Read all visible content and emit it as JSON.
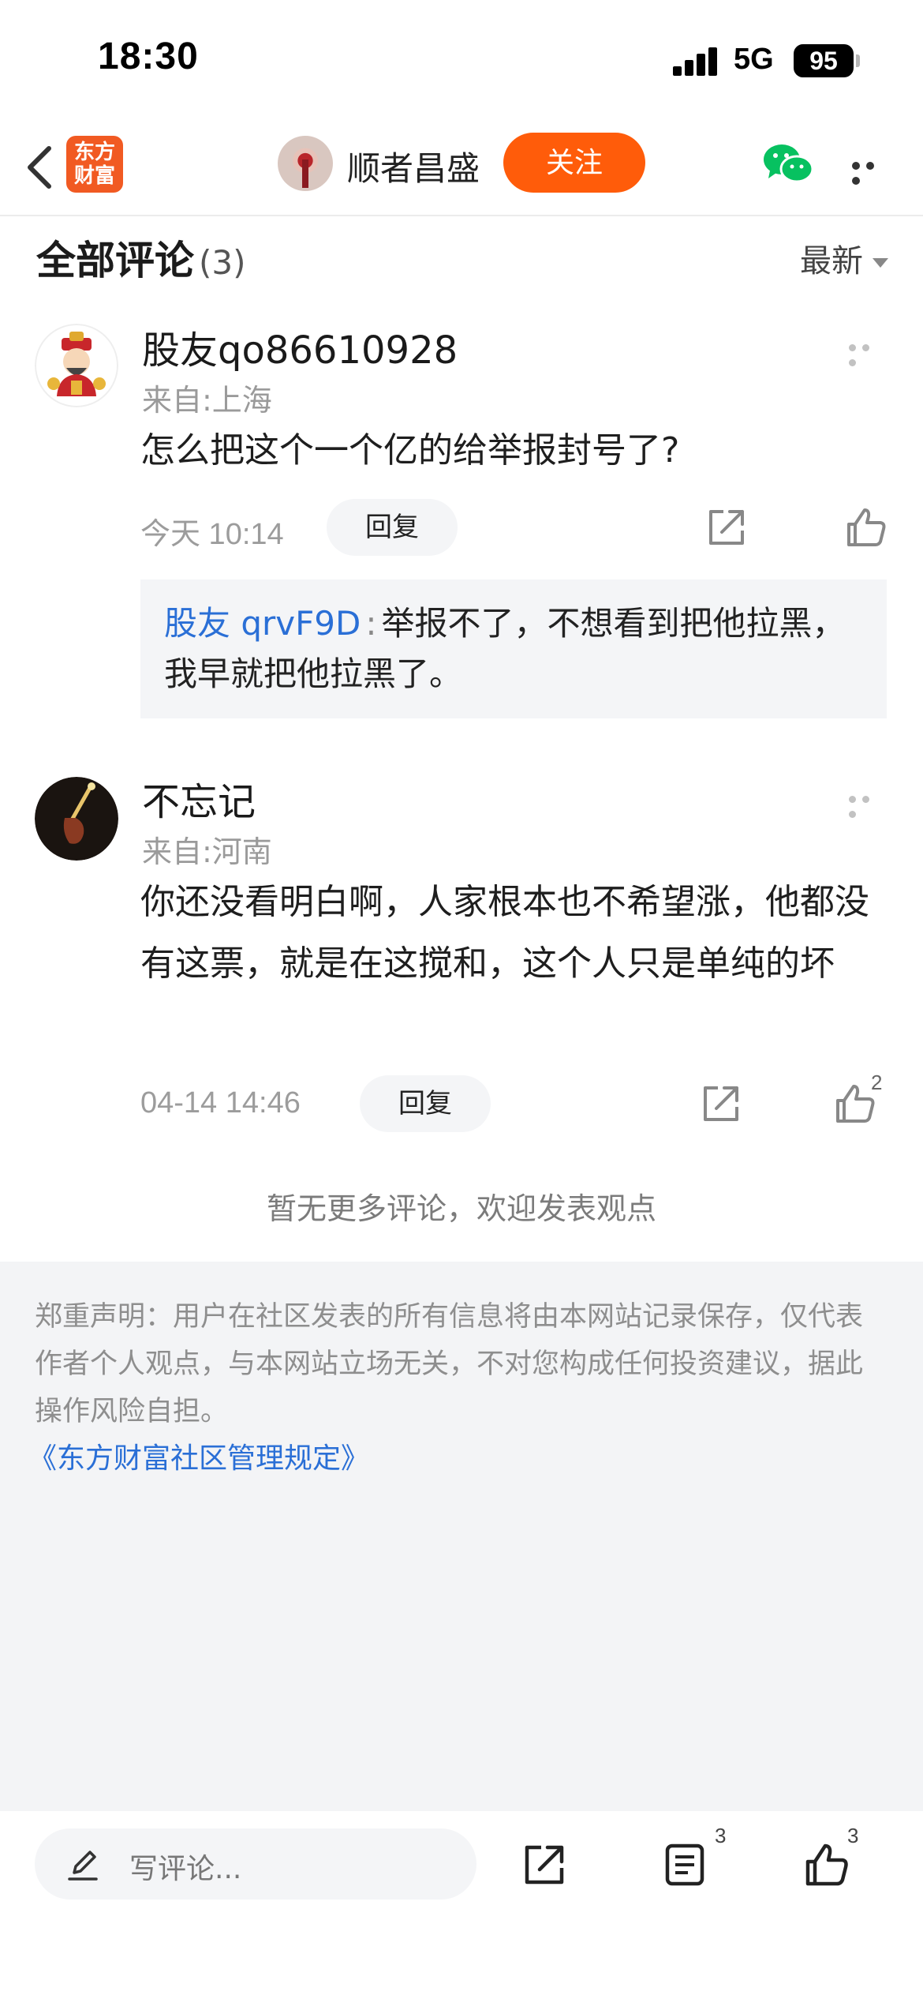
{
  "status_bar": {
    "time": "18:30",
    "network": "5G",
    "battery": "95"
  },
  "navbar": {
    "logo_line1": "东方",
    "logo_line2": "财富",
    "username": "顺者昌盛",
    "follow_label": "关注"
  },
  "comments_header": {
    "title": "全部评论",
    "count": "(3)",
    "sort": "最新"
  },
  "comments": [
    {
      "user": "股友qo86610928",
      "location": "来自:上海",
      "body": "怎么把这个一个亿的给举报封号了?",
      "time": "今天 10:14",
      "reply_label": "回复",
      "likes": "",
      "reply": {
        "user": "股友 qrvF9D",
        "separator": ":",
        "text": "举报不了，不想看到把他拉黑，我早就把他拉黑了。"
      }
    },
    {
      "user": "不忘记",
      "location": "来自:河南",
      "body": "你还没看明白啊，人家根本也不希望涨，他都没有这票，就是在这搅和，这个人只是单纯的坏",
      "time": "04-14 14:46",
      "reply_label": "回复",
      "likes": "2"
    }
  ],
  "no_more_text": "暂无更多评论，欢迎发表观点",
  "disclaimer": {
    "text": "郑重声明：用户在社区发表的所有信息将由本网站记录保存，仅代表作者个人观点，与本网站立场无关，不对您构成任何投资建议，据此操作风险自担。",
    "link": "《东方财富社区管理规定》"
  },
  "bottom_bar": {
    "input_placeholder": "写评论...",
    "comments_badge": "3",
    "likes_badge": "3"
  },
  "colors": {
    "accent": "#ff5c0a",
    "link": "#2a6fd6",
    "wechat": "#07c160"
  }
}
